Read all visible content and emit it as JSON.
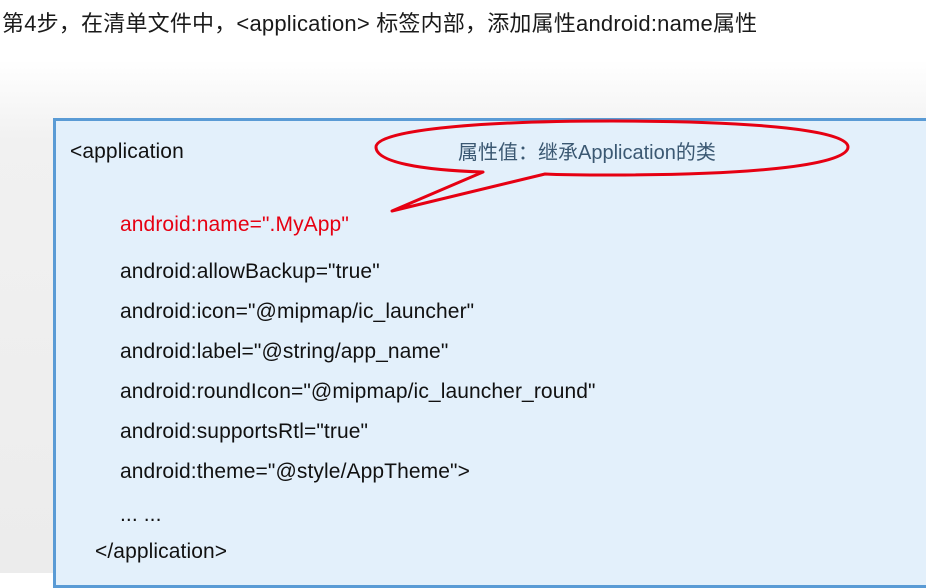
{
  "heading": "第4步，在清单文件中，<application> 标签内部，添加属性android:name属性",
  "callout": {
    "text": "属性值：继承Application的类",
    "stroke_color": "#e60012"
  },
  "code": {
    "open_tag": "<application",
    "name_attr": "android:name=\".MyApp\"",
    "attrs": [
      "android:allowBackup=\"true\"",
      "android:icon=\"@mipmap/ic_launcher\"",
      "android:label=\"@string/app_name\"",
      "android:roundIcon=\"@mipmap/ic_launcher_round\"",
      "android:supportsRtl=\"true\"",
      "android:theme=\"@style/AppTheme\">"
    ],
    "ellipsis": "...   ...",
    "close_tag": "</application>"
  },
  "colors": {
    "box_border": "#5a9bd5",
    "box_fill": "#e3f0fb",
    "highlight": "#e60012"
  }
}
